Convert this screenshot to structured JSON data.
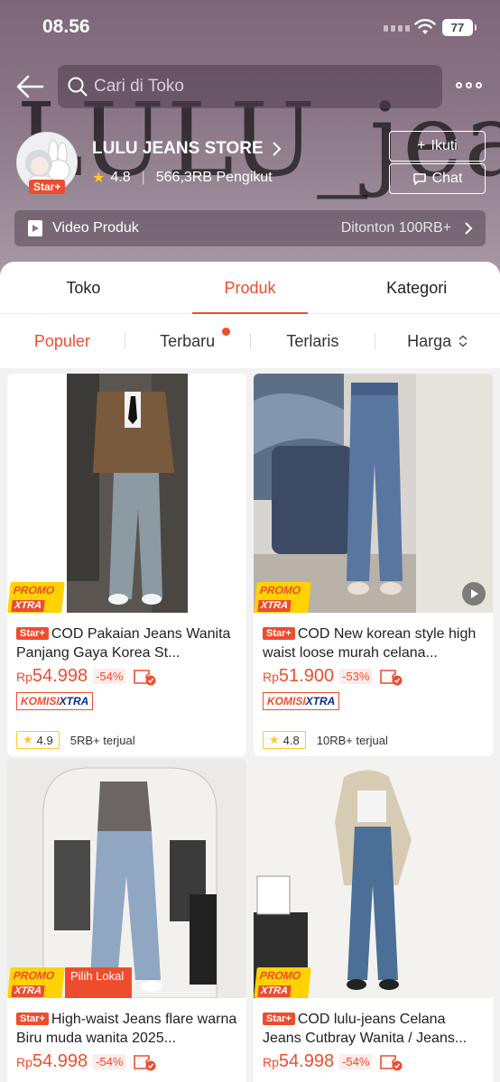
{
  "status": {
    "time": "08.56",
    "battery": "77"
  },
  "search": {
    "placeholder": "Cari di Toko"
  },
  "store": {
    "banner_text": "LULU_jeans",
    "name": "LULU JEANS STORE",
    "badge": "Star+",
    "rating": "4.8",
    "followers": "566,3RB Pengikut",
    "follow_label": "Ikuti",
    "chat_label": "Chat"
  },
  "video": {
    "label": "Video Produk",
    "views": "Ditonton 100RB+"
  },
  "tabs": [
    {
      "label": "Toko"
    },
    {
      "label": "Produk"
    },
    {
      "label": "Kategori"
    }
  ],
  "sort": [
    {
      "label": "Populer"
    },
    {
      "label": "Terbaru"
    },
    {
      "label": "Terlaris"
    },
    {
      "label": "Harga"
    }
  ],
  "promo": {
    "line1": "PROMO",
    "line2": "XTRA",
    "lokal": "Pilih Lokal"
  },
  "products": [
    {
      "badge": "Star+",
      "title": "COD Pakaian Jeans Wanita Panjang Gaya Korea St...",
      "currency": "Rp",
      "price": "54.998",
      "discount": "-54%",
      "komisi1": "KOMISI",
      "komisi2": "XTRA",
      "rating": "4.9",
      "sold": "5RB+ terjual"
    },
    {
      "badge": "Star+",
      "title": "COD New korean style high waist loose murah celana...",
      "currency": "Rp",
      "price": "51.900",
      "discount": "-53%",
      "komisi1": "KOMISI",
      "komisi2": "XTRA",
      "rating": "4.8",
      "sold": "10RB+ terjual"
    },
    {
      "badge": "Star+",
      "title": "High-waist Jeans flare warna Biru muda wanita 2025...",
      "currency": "Rp",
      "price": "54.998",
      "discount": "-54%"
    },
    {
      "badge": "Star+",
      "title": "COD lulu-jeans Celana Jeans Cutbray Wanita / Jeans...",
      "currency": "Rp",
      "price": "54.998",
      "discount": "-54%"
    }
  ]
}
